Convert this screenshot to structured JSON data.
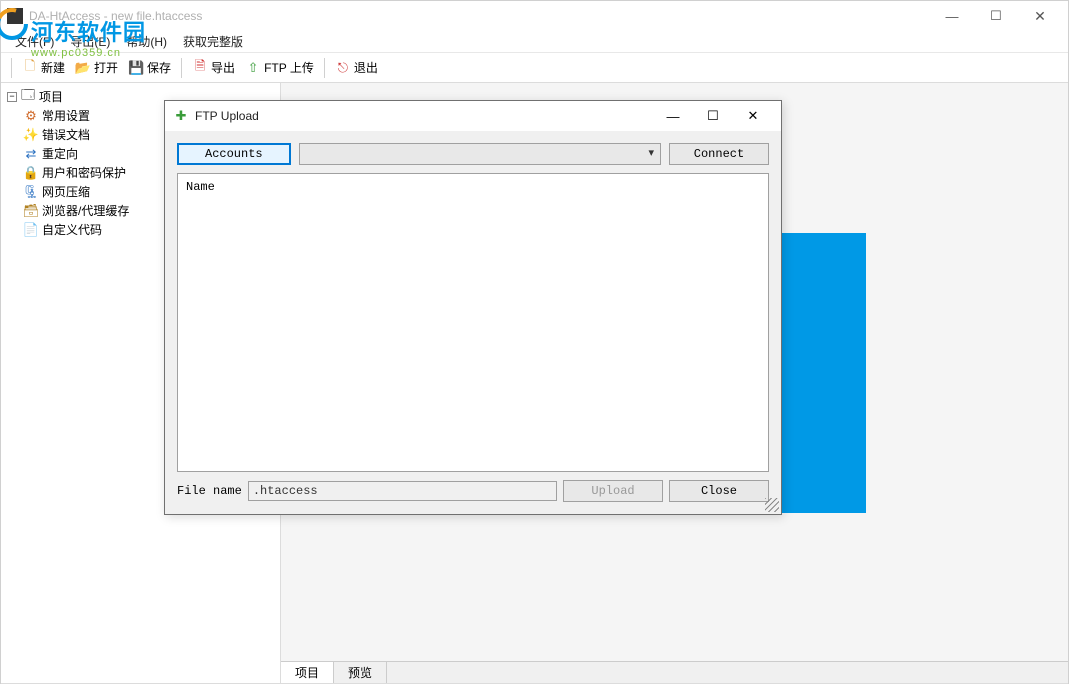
{
  "main": {
    "title": "DA-HtAccess - new file.htaccess"
  },
  "menu": {
    "file": "文件(F)",
    "export": "导出(E)",
    "help": "帮助(H)",
    "full_version": "获取完整版"
  },
  "toolbar": {
    "new": "新建",
    "open": "打开",
    "save": "保存",
    "export": "导出",
    "ftp": "FTP 上传",
    "exit": "退出"
  },
  "tree": {
    "root": "项目",
    "items": {
      "0": {
        "label": "常用设置"
      },
      "1": {
        "label": "错误文档"
      },
      "2": {
        "label": "重定向"
      },
      "3": {
        "label": "用户和密码保护"
      },
      "4": {
        "label": "网页压缩"
      },
      "5": {
        "label": "浏览器/代理缓存"
      },
      "6": {
        "label": "自定义代码"
      }
    }
  },
  "bottom_tabs": {
    "project": "项目",
    "preview": "预览"
  },
  "dialog": {
    "title": "FTP Upload",
    "accounts": "Accounts",
    "connect": "Connect",
    "name_header": "Name",
    "file_label": "File name",
    "file_value": ".htaccess",
    "upload": "Upload",
    "close": "Close"
  },
  "watermark": {
    "name": "河东软件园",
    "url": "www.pc0359.cn"
  },
  "colors": {
    "accent_blue": "#0099e6",
    "button_active": "#0078d4"
  }
}
